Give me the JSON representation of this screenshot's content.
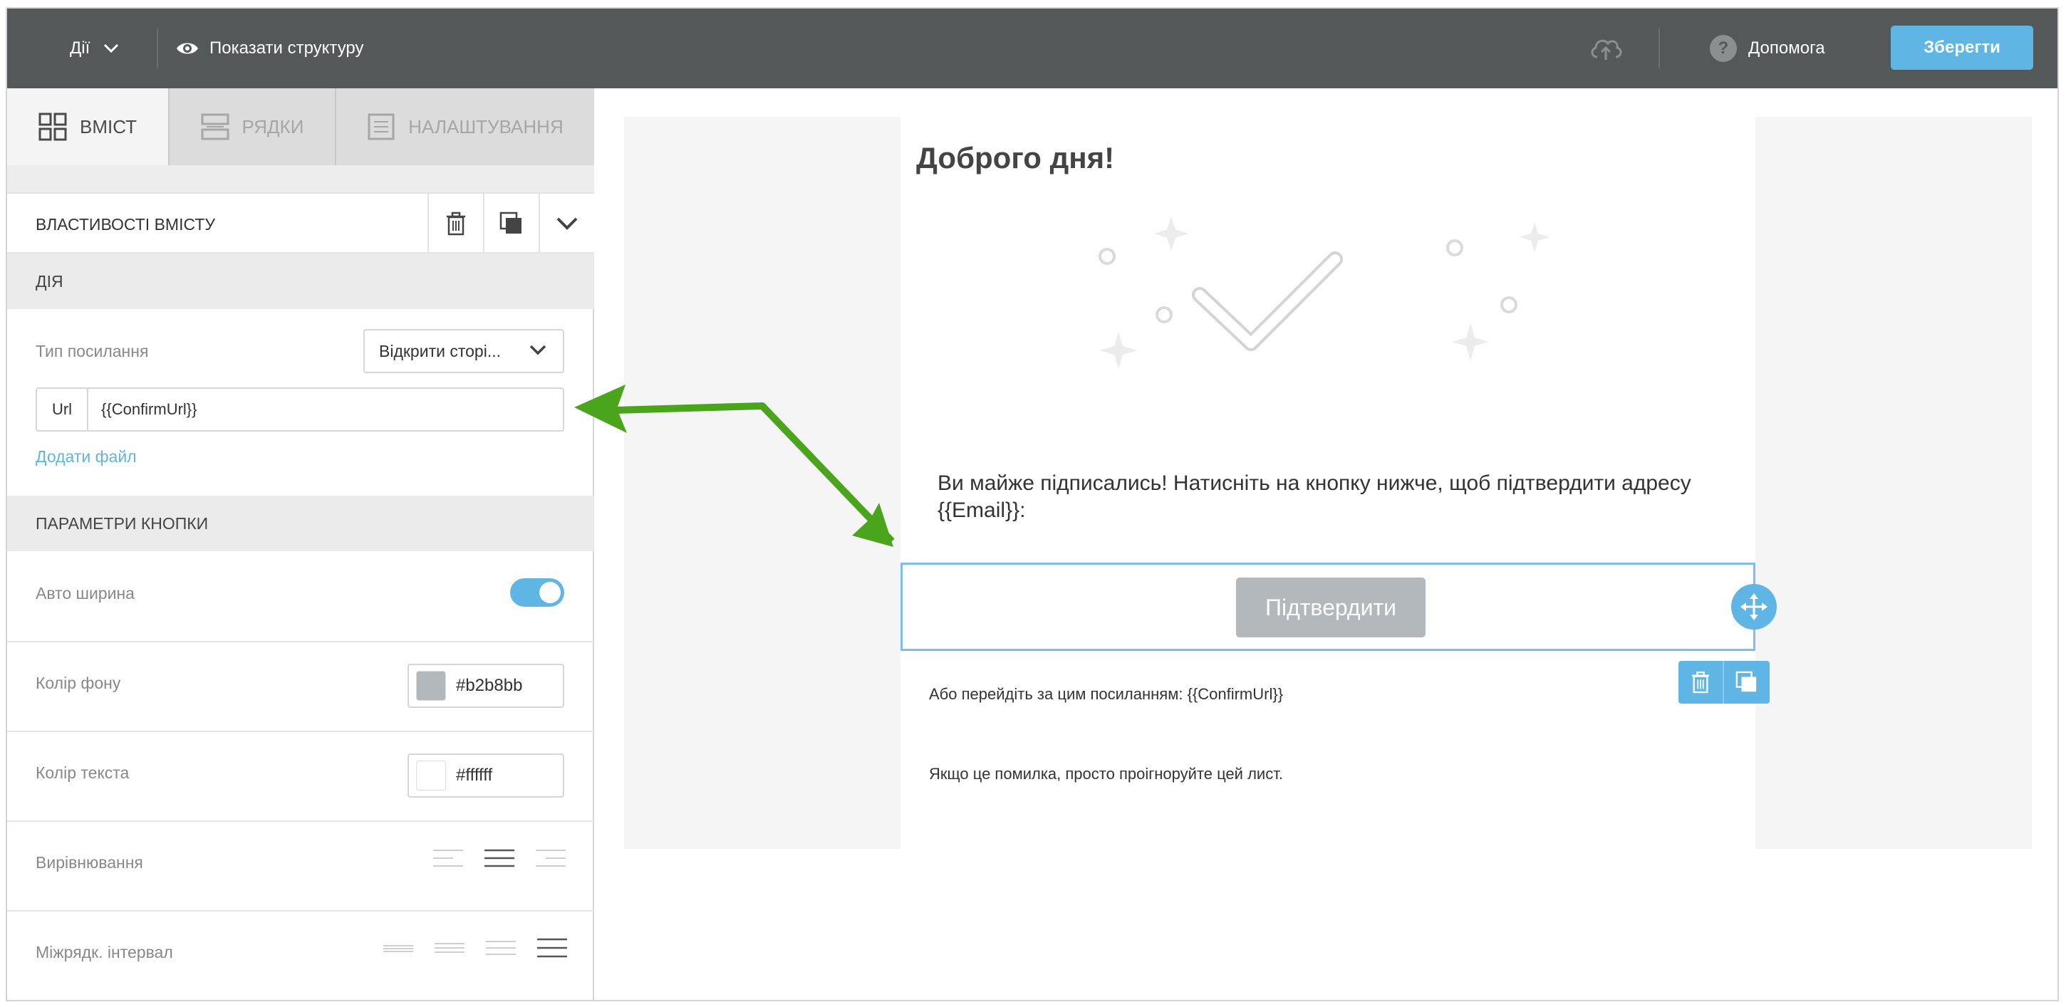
{
  "topbar": {
    "actions_label": "Дії",
    "show_structure_label": "Показати структуру",
    "help_label": "Допомога",
    "save_label": "Зберегти"
  },
  "tabs": [
    {
      "label": "ВМІСТ",
      "icon": "grid-icon",
      "active": true
    },
    {
      "label": "РЯДКИ",
      "icon": "rows-icon",
      "active": false
    },
    {
      "label": "НАЛАШТУВАННЯ",
      "icon": "settings-doc-icon",
      "active": false
    }
  ],
  "panel": {
    "title": "ВЛАСТИВОСТІ ВМІСТУ",
    "sections": {
      "action": "ДІЯ",
      "button_params": "ПАРАМЕТРИ КНОПКИ"
    },
    "link_type_label": "Тип посилання",
    "link_type_value": "Відкрити сторі...",
    "url_prefix": "Url",
    "url_value": "{{ConfirmUrl}}",
    "add_file": "Додати файл",
    "auto_width_label": "Авто ширина",
    "auto_width_on": true,
    "bg_color_label": "Колір фону",
    "bg_color_value": "#b2b8bb",
    "text_color_label": "Колір текста",
    "text_color_value": "#ffffff",
    "alignment_label": "Вирівнювання",
    "line_height_label": "Міжрядк. інтервал"
  },
  "email": {
    "heading": "Доброго дня!",
    "body": "Ви майже підписались! Натисніть на кнопку нижче, щоб підтвердити адресу {{Email}}:",
    "button_label": "Підтвердити",
    "link_line": "Або перейдіть за цим посиланням: {{ConfirmUrl}}",
    "error_line": "Якщо це помилка, просто проігноруйте цей лист."
  },
  "colors": {
    "topbar": "#545859",
    "accent": "#5fb5e4",
    "button_bg": "#b2b8bb",
    "arrow": "#4aa41c"
  }
}
